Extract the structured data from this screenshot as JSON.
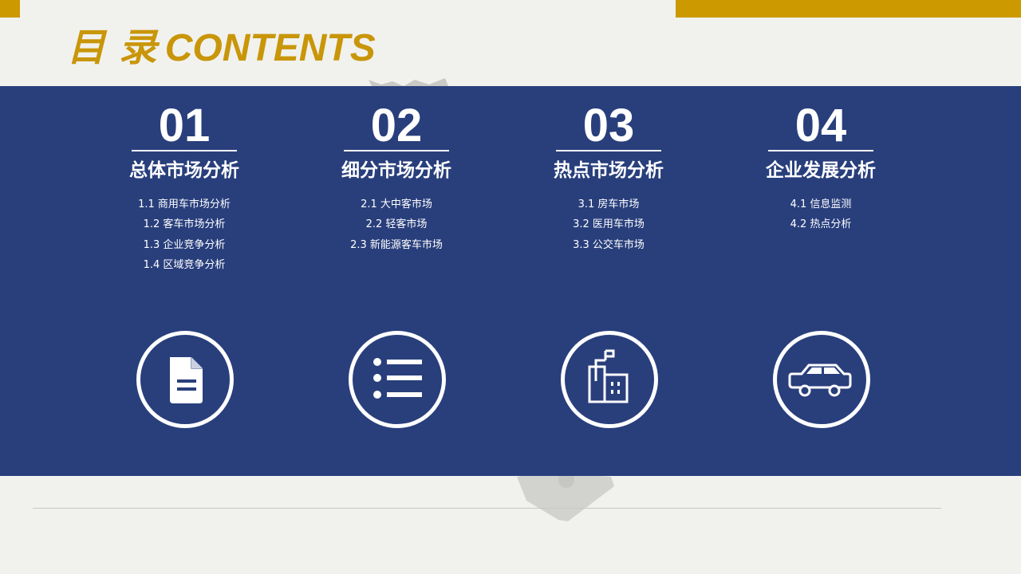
{
  "title": {
    "cn": "目 录",
    "en": "CONTENTS"
  },
  "colors": {
    "accent_gold": "#cc9900",
    "band_blue": "#293f7c",
    "background": "#f1f2ee"
  },
  "sections": [
    {
      "number": "01",
      "heading": "总体市场分析",
      "items": [
        "1.1 商用车市场分析",
        "1.2 客车市场分析",
        "1.3 企业竞争分析",
        "1.4 区域竞争分析"
      ],
      "icon": "document-icon"
    },
    {
      "number": "02",
      "heading": "细分市场分析",
      "items": [
        "2.1 大中客市场",
        "2.2 轻客市场",
        "2.3 新能源客车市场"
      ],
      "icon": "list-icon"
    },
    {
      "number": "03",
      "heading": "热点市场分析",
      "items": [
        "3.1 房车市场",
        "3.2 医用车市场",
        "3.3 公交车市场"
      ],
      "icon": "building-icon"
    },
    {
      "number": "04",
      "heading": "企业发展分析",
      "items": [
        "4.1 信息监测",
        "4.2 热点分析"
      ],
      "icon": "car-icon"
    }
  ]
}
